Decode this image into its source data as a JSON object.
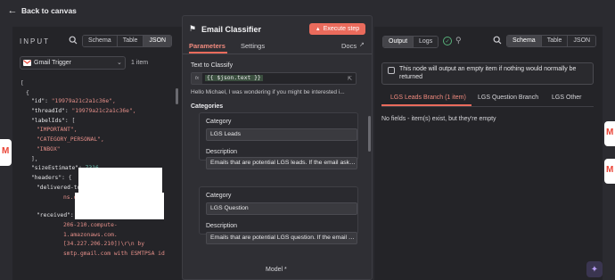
{
  "topbar": {
    "back_label": "Back to canvas"
  },
  "input": {
    "title": "INPUT",
    "view_modes": [
      "Schema",
      "Table",
      "JSON"
    ],
    "active_view": "JSON",
    "node_select": "Gmail Trigger",
    "item_count": "1 item",
    "json_lines": [
      {
        "text": "[",
        "cls": "p",
        "indent": 0
      },
      {
        "text": "{",
        "cls": "p",
        "indent": 1
      },
      {
        "key": "\"id\": ",
        "val": "\"19979a21c2a1c36e\",",
        "cls": "s",
        "indent": 2
      },
      {
        "key": "\"threadId\": ",
        "val": "\"19979a21c2a1c36e\",",
        "cls": "s",
        "indent": 2
      },
      {
        "key": "\"labelIds\": ",
        "val": "[",
        "cls": "p",
        "indent": 2
      },
      {
        "text": "\"IMPORTANT\",",
        "cls": "s",
        "indent": 3
      },
      {
        "text": "\"CATEGORY_PERSONAL\",",
        "cls": "s",
        "indent": 3
      },
      {
        "text": "\"INBOX\"",
        "cls": "s",
        "indent": 3
      },
      {
        "text": "],",
        "cls": "p",
        "indent": 2
      },
      {
        "key": "\"sizeEstimate\": ",
        "val": "7316,",
        "cls": "n",
        "indent": 2
      },
      {
        "key": "\"headers\": ",
        "val": "{",
        "cls": "p",
        "indent": 2
      },
      {
        "key": "\"delivered-to\": ",
        "val": "\"Delivered-To:",
        "cls": "s",
        "indent": 3
      },
      {
        "text": "ns.com\",",
        "cls": "s",
        "indent": 8
      },
      {
        "key": "\"received\": ",
        "val": "",
        "cls": "s",
        "indent": 3
      },
      {
        "text": "206-210.compute-",
        "cls": "s",
        "indent": 8
      },
      {
        "text": "1.amazonaws.com.",
        "cls": "s",
        "indent": 8
      },
      {
        "text": "[34.227.206.210])\\r\\n        by",
        "cls": "s",
        "indent": 8
      },
      {
        "text": "smtp.gmail.com with ESMTPSA id",
        "cls": "s",
        "indent": 8
      }
    ]
  },
  "modal": {
    "title": "Email Classifier",
    "execute_label": "Execute step",
    "tabs": {
      "parameters": "Parameters",
      "settings": "Settings",
      "docs": "Docs"
    },
    "text_to_classify_label": "Text to Classify",
    "expression": "{{ $json.text }}",
    "expression_preview": "Hello Michael, I was wondering if you might be interested i...",
    "categories_label": "Categories",
    "categories": [
      {
        "category_label": "Category",
        "category_value": "LGS Leads",
        "description_label": "Description",
        "description_value": "Emails that are potential LGS leads. If the email asks a"
      },
      {
        "category_label": "Category",
        "category_value": "LGS Question",
        "description_label": "Description",
        "description_value": "Emails that are potential LGS question. If the email ask"
      }
    ],
    "model_label": "Model *"
  },
  "output": {
    "run_modes": [
      "Output",
      "Logs"
    ],
    "active_run_mode": "Output",
    "view_modes": [
      "Schema",
      "Table",
      "JSON"
    ],
    "active_view": "Schema",
    "info_text": "This node will output an empty item if nothing would normally be returned",
    "branches": [
      "LGS Leads Branch (1 item)",
      "LGS Question Branch",
      "LGS Other"
    ],
    "active_branch": 0,
    "no_fields_text": "No fields - item(s) exist, but they're empty"
  },
  "colors": {
    "accent": "#ea6b5c",
    "panel_bg": "#242428",
    "canvas_bg": "#2b2b30",
    "success": "#57b07a"
  },
  "icons": {
    "back": "arrow-left-icon",
    "search": "search-icon",
    "node": "gmail-icon",
    "tag": "tag-icon",
    "status": "check-circle-icon",
    "pin": "pin-icon",
    "info": "info-square-icon",
    "sparkle": "sparkle-icon"
  }
}
